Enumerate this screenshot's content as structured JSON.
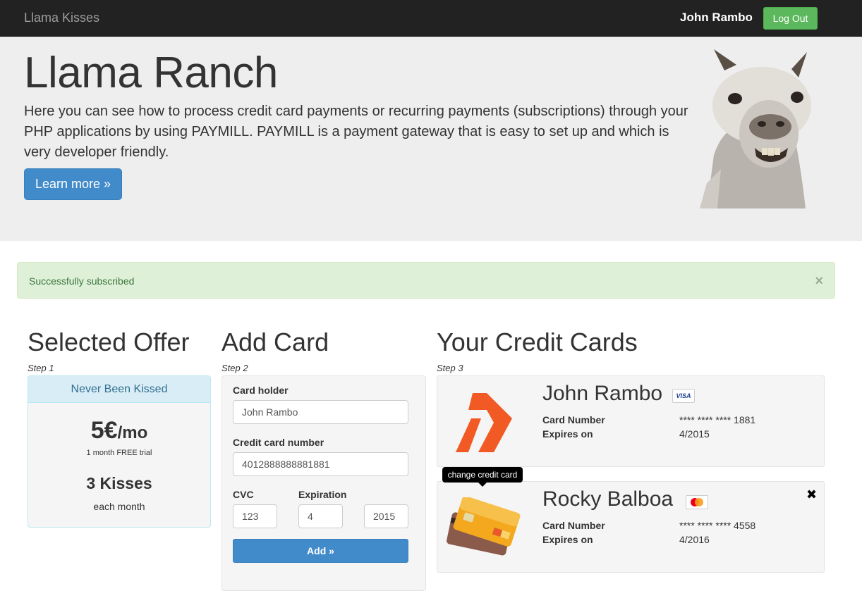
{
  "navbar": {
    "brand": "Llama Kisses",
    "user": "John Rambo",
    "logout_label": "Log Out"
  },
  "jumbotron": {
    "title": "Llama Ranch",
    "text": "Here you can see how to process credit card payments or recurring payments (subscriptions) through your PHP applications by using PAYMILL. PAYMILL is a payment gateway that is easy to set up and which is very developer friendly.",
    "button_label": "Learn more »"
  },
  "alert": {
    "message": "Successfully subscribed",
    "close": "×"
  },
  "offer": {
    "heading": "Selected Offer",
    "step": "Step 1",
    "name": "Never Been Kissed",
    "price": "5€",
    "period": "/mo",
    "trial": "1 month FREE trial",
    "kisses": "3 Kisses",
    "frequency": "each month"
  },
  "add_card": {
    "heading": "Add Card",
    "step": "Step 2",
    "holder_label": "Card holder",
    "holder_value": "John Rambo",
    "number_label": "Credit card number",
    "number_value": "4012888888881881",
    "cvc_label": "CVC",
    "cvc_value": "123",
    "expiration_label": "Expiration",
    "exp_month": "4",
    "exp_year": "2015",
    "add_label": "Add »"
  },
  "cards": {
    "heading": "Your Credit Cards",
    "step": "Step 3",
    "number_label": "Card Number",
    "expires_label": "Expires on",
    "items": [
      {
        "holder": "John Rambo",
        "brand": "VISA",
        "number": "**** **** **** 1881",
        "expires": "4/2015",
        "icon": "paymill-logo-icon"
      },
      {
        "holder": "Rocky Balboa",
        "brand": "mastercard",
        "number": "**** **** **** 4558",
        "expires": "4/2016",
        "icon": "credit-cards-icon"
      }
    ],
    "tooltip": "change credit card",
    "remove": "✖"
  },
  "colors": {
    "navbar": "#222222",
    "success_green": "#5cb85c",
    "primary_blue": "#428bca",
    "paymill_orange": "#f15a24"
  }
}
